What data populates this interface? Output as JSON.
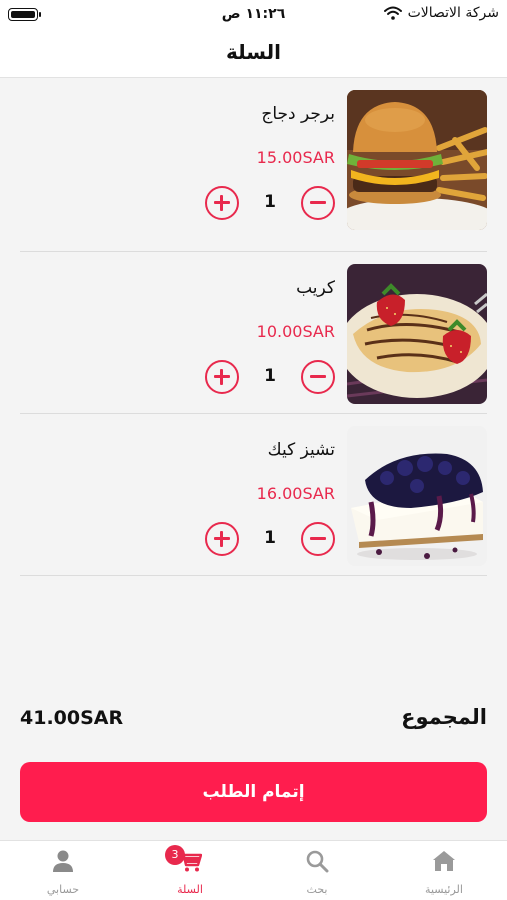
{
  "status_bar": {
    "carrier": "شركة الاتصالات",
    "time": "١١:٢٦ ص"
  },
  "header": {
    "title": "السلة"
  },
  "cart": {
    "items": [
      {
        "name": "برجر دجاج",
        "price": "15.00SAR",
        "quantity": "1",
        "image": "burger-image"
      },
      {
        "name": "كريب",
        "price": "10.00SAR",
        "quantity": "1",
        "image": "crepe-image"
      },
      {
        "name": "تشيز كيك",
        "price": "16.00SAR",
        "quantity": "1",
        "image": "cheesecake-image"
      }
    ]
  },
  "summary": {
    "total_label": "المجموع",
    "total_value": "41.00SAR"
  },
  "checkout": {
    "label": "إتمام الطلب"
  },
  "bottom_nav": {
    "items": [
      {
        "label": "الرئيسية",
        "icon": "home-icon"
      },
      {
        "label": "بحث",
        "icon": "search-icon"
      },
      {
        "label": "السلة",
        "icon": "cart-icon",
        "badge": "3",
        "active": true
      },
      {
        "label": "حسابي",
        "icon": "user-icon"
      }
    ]
  },
  "colors": {
    "accent": "#e8294d",
    "button": "#ff1d4e",
    "background": "#f4f4f4"
  }
}
